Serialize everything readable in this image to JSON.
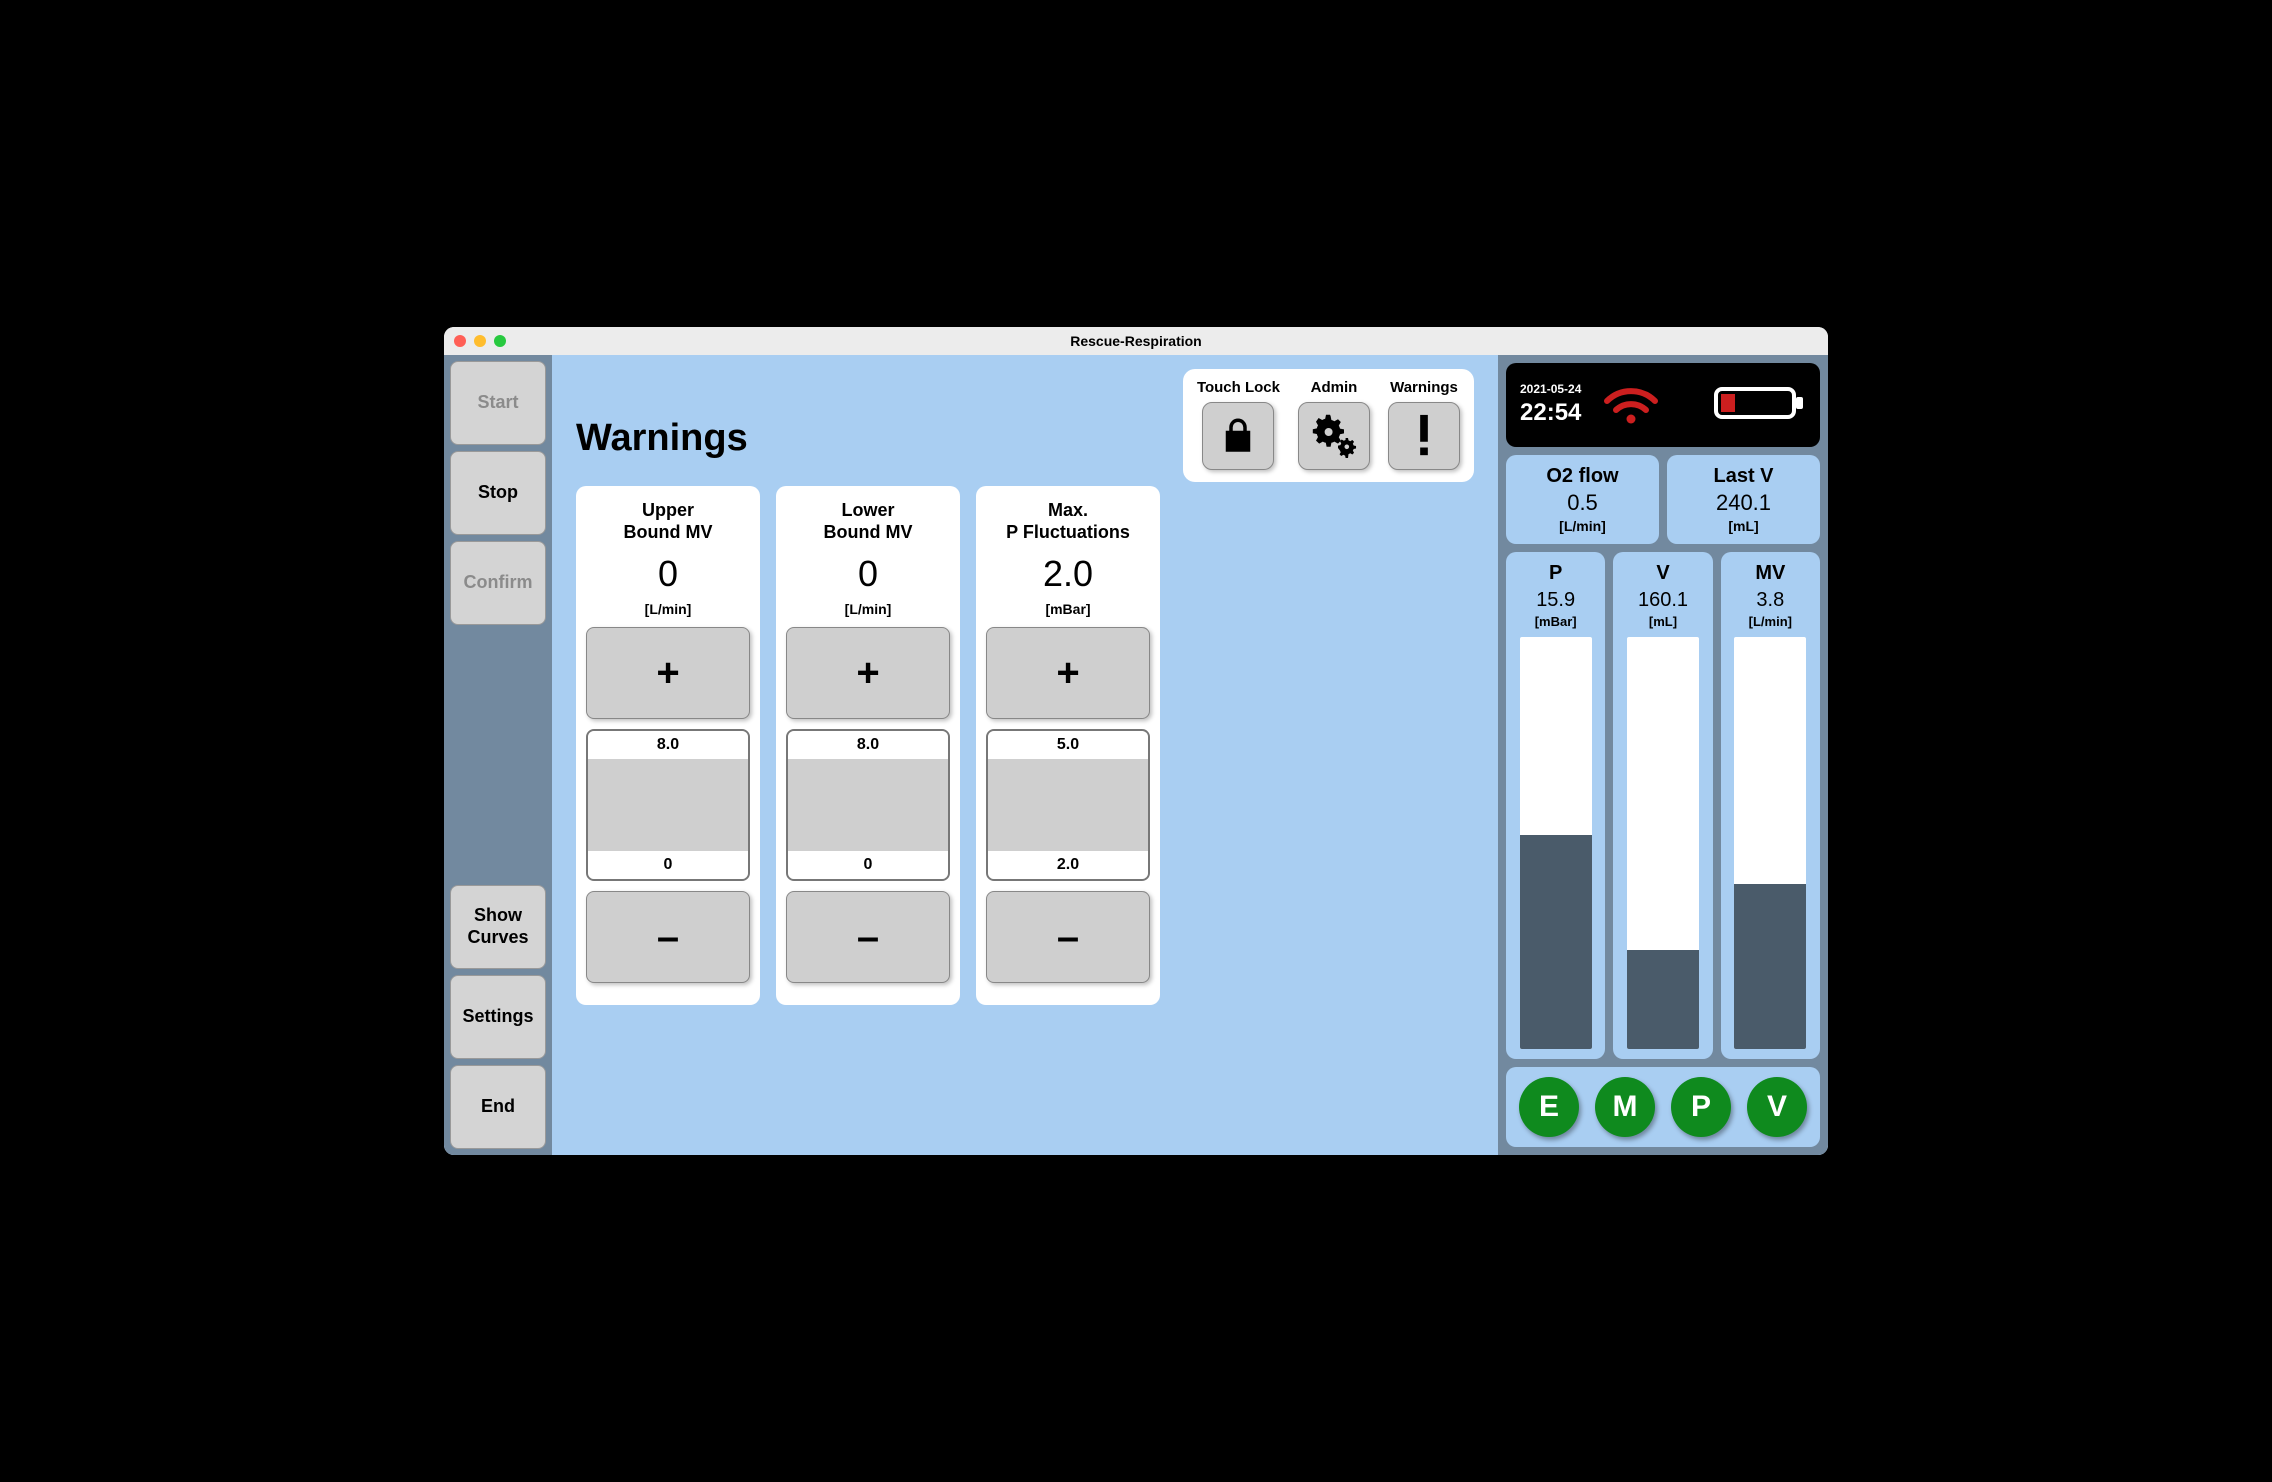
{
  "window": {
    "title": "Rescue-Respiration"
  },
  "left": {
    "start": "Start",
    "stop": "Stop",
    "confirm": "Confirm",
    "show_curves": "Show Curves",
    "settings": "Settings",
    "end": "End"
  },
  "main": {
    "title": "Warnings",
    "top_actions": {
      "touch_lock": "Touch Lock",
      "admin": "Admin",
      "warnings": "Warnings"
    },
    "cards": [
      {
        "title": "Upper Bound MV",
        "value": "0",
        "unit": "[L/min]",
        "slider_top": "8.0",
        "slider_bot": "0"
      },
      {
        "title": "Lower Bound MV",
        "value": "0",
        "unit": "[L/min]",
        "slider_top": "8.0",
        "slider_bot": "0"
      },
      {
        "title": "Max. P Fluctuations",
        "value": "2.0",
        "unit": "[mBar]",
        "slider_top": "5.0",
        "slider_bot": "2.0"
      }
    ],
    "plus": "+",
    "minus": "–"
  },
  "status": {
    "date": "2021-05-24",
    "time": "22:54"
  },
  "tiles": {
    "o2flow": {
      "label": "O2 flow",
      "value": "0.5",
      "unit": "[L/min]"
    },
    "lastv": {
      "label": "Last V",
      "value": "240.1",
      "unit": "[mL]"
    }
  },
  "gauges": [
    {
      "label": "P",
      "value": "15.9",
      "unit": "[mBar]",
      "fill_pct": 52
    },
    {
      "label": "V",
      "value": "160.1",
      "unit": "[mL]",
      "fill_pct": 24
    },
    {
      "label": "MV",
      "value": "3.8",
      "unit": "[L/min]",
      "fill_pct": 40
    }
  ],
  "green_buttons": [
    "E",
    "M",
    "P",
    "V"
  ]
}
